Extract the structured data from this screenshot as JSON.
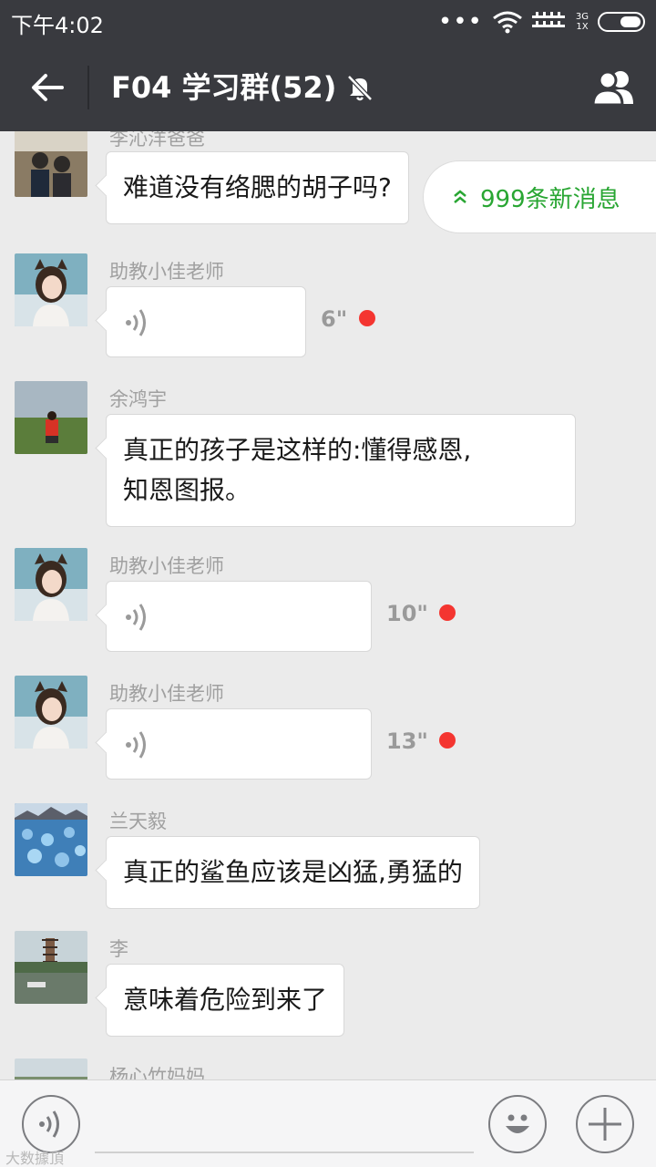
{
  "status": {
    "time": "下午4:02",
    "network_top": "3G",
    "network_bottom": "1X"
  },
  "header": {
    "title": "F04 学习群(52)"
  },
  "new_messages": {
    "label": "999条新消息"
  },
  "messages": [
    {
      "sender": "李沁洋爸爸",
      "type": "text",
      "text": "难道没有络腮的胡子吗?"
    },
    {
      "sender": "助教小佳老师",
      "type": "voice",
      "duration": "6\""
    },
    {
      "sender": "余鸿宇",
      "type": "text",
      "line1": "真正的孩子是这样的:懂得感恩,",
      "line2": "知恩图报。"
    },
    {
      "sender": "助教小佳老师",
      "type": "voice",
      "duration": "10\""
    },
    {
      "sender": "助教小佳老师",
      "type": "voice",
      "duration": "13\""
    },
    {
      "sender": "兰天毅",
      "type": "text",
      "text": "真正的鲨鱼应该是凶猛,勇猛的"
    },
    {
      "sender": "李",
      "type": "text",
      "text": "意味着危险到来了"
    },
    {
      "sender": "杨心竹妈妈",
      "type": "text",
      "text": ""
    }
  ],
  "watermark": "大数據頂",
  "icons": {
    "back": "arrow-left-icon",
    "mute": "bell-off-icon",
    "members": "group-members-icon",
    "voice": "voice-wave-icon",
    "emoji": "smiley-icon",
    "plus": "plus-icon",
    "chevron": "double-chevron-up-icon"
  },
  "colors": {
    "header_bg": "#393a3f",
    "chat_bg": "#ebebeb",
    "accent_green": "#29a633",
    "unread_red": "#f43530"
  }
}
